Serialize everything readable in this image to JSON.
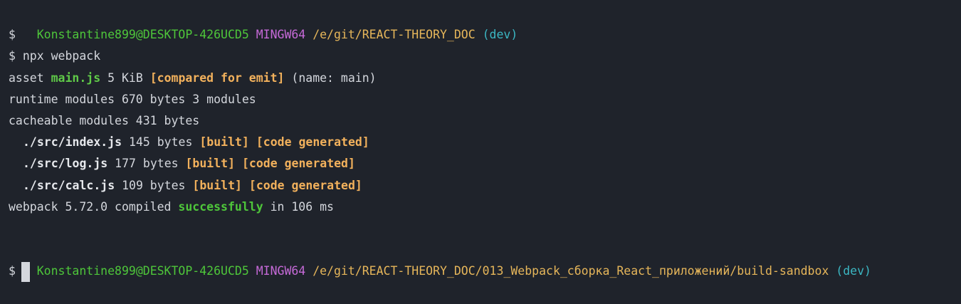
{
  "prompt1": {
    "user": "Konstantine899@DESKTOP-426UCD5",
    "shell": "MINGW64",
    "path": "/e/git/REACT-THEORY_DOC",
    "branch": "(dev)"
  },
  "lines": {
    "empty_prompt": "$",
    "command_prompt": "$ npx webpack",
    "asset_prefix": "asset ",
    "asset_name": "main.js",
    "asset_size": " 5 KiB ",
    "asset_status": "[compared for emit]",
    "asset_suffix": " (name: main)",
    "runtime": "runtime modules 670 bytes 3 modules",
    "cacheable": "cacheable modules 431 bytes",
    "modules": [
      {
        "file": "./src/index.js",
        "size": " 145 bytes ",
        "built": "[built]",
        "generated": "[code generated]"
      },
      {
        "file": "./src/log.js",
        "size": " 177 bytes ",
        "built": "[built]",
        "generated": "[code generated]"
      },
      {
        "file": "./src/calc.js",
        "size": " 109 bytes ",
        "built": "[built]",
        "generated": "[code generated]"
      }
    ],
    "summary_prefix": "webpack 5.72.0 compiled ",
    "summary_status": "successfully",
    "summary_suffix": " in 106 ms"
  },
  "prompt2": {
    "user": "Konstantine899@DESKTOP-426UCD5",
    "shell": "MINGW64",
    "path": "/e/git/REACT-THEORY_DOC/013_Webpack_сборка_React_приложений/build-sandbox",
    "branch": "(dev)"
  },
  "final_prompt": "$"
}
